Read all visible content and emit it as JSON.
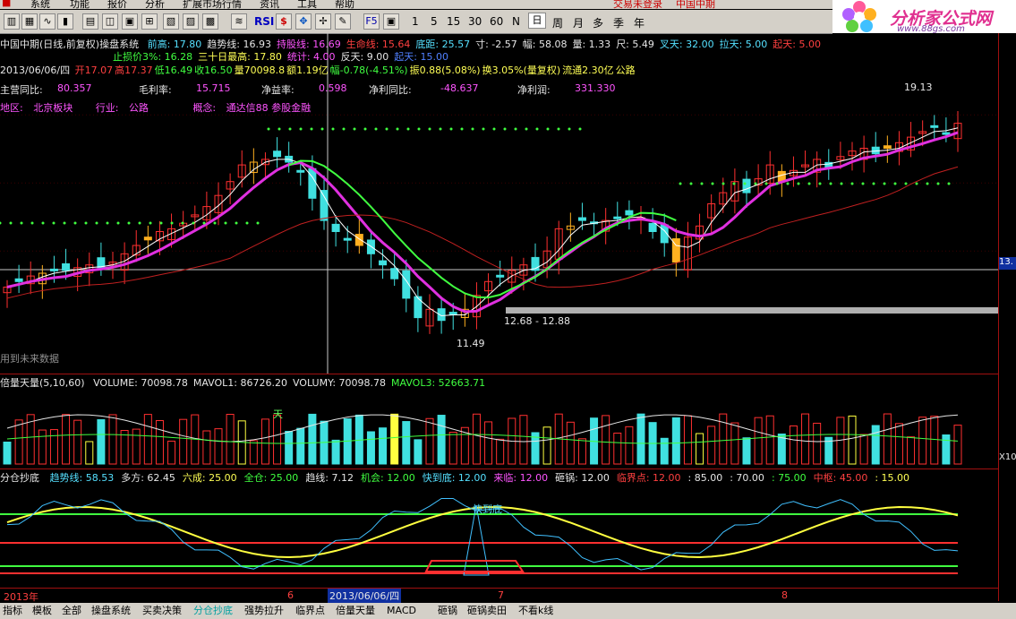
{
  "menu": [
    "系统",
    "功能",
    "报价",
    "分析",
    "扩展市场行情",
    "资讯",
    "工具",
    "帮助"
  ],
  "top_status": "交易未登录",
  "top_stock": "中国中期",
  "toolbar": {
    "rsi_label": "RSI",
    "period_labels": [
      "1",
      "5",
      "15",
      "30",
      "60",
      "N",
      "日",
      "周",
      "月",
      "多",
      "季",
      "年"
    ]
  },
  "brand": {
    "title": "分析家公式网",
    "url": "www.88gs.com"
  },
  "header": {
    "line1": {
      "title": "中国中期(日线,前复权)操盘系统",
      "items": [
        {
          "text": "前高: 17.80",
          "color": "#55e0ff"
        },
        {
          "text": "趋势线: 16.93",
          "color": "#e6e6e6"
        },
        {
          "text": "持股线: 16.69",
          "color": "#ff55ff"
        },
        {
          "text": "生命线: 15.64",
          "color": "#ff4040"
        },
        {
          "text": "底距: 25.57",
          "color": "#55e0ff"
        },
        {
          "text": "寸: -2.57",
          "color": "#e6e6e6"
        },
        {
          "text": "幅: 58.08",
          "color": "#e6e6e6"
        },
        {
          "text": "量: 1.33",
          "color": "#e6e6e6"
        },
        {
          "text": "尺: 5.49",
          "color": "#e6e6e6"
        },
        {
          "text": "叉天: 32.00",
          "color": "#55e0ff"
        },
        {
          "text": "拉天: 5.00",
          "color": "#55e0ff"
        },
        {
          "text": "起天: 5.00",
          "color": "#ff4040"
        }
      ]
    },
    "line2": [
      {
        "text": "止损价3%: 16.28",
        "color": "#40ff40"
      },
      {
        "text": "三十日最高: 17.80",
        "color": "#ffff55"
      },
      {
        "text": "统计: 4.00",
        "color": "#ff55ff"
      },
      {
        "text": "反天: 9.00",
        "color": "#e6e6e6"
      },
      {
        "text": "起天: 15.00",
        "color": "#5080ff"
      }
    ],
    "line3": {
      "date": "2013/06/06/四",
      "items": [
        {
          "text": "开17.07",
          "color": "#ff4040"
        },
        {
          "text": "高17.37",
          "color": "#ff4040"
        },
        {
          "text": "低16.49",
          "color": "#40ff40"
        },
        {
          "text": "收16.50",
          "color": "#40ff40"
        },
        {
          "text": "量70098.8",
          "color": "#ffff55"
        },
        {
          "text": "额1.19亿",
          "color": "#ffff55"
        },
        {
          "text": "幅-0.78(-4.51%)",
          "color": "#40ff40"
        },
        {
          "text": "振0.88(5.08%)",
          "color": "#ffff55"
        },
        {
          "text": "换3.05%(量复权)",
          "color": "#ffff55"
        },
        {
          "text": "流通2.30亿",
          "color": "#ffff55"
        },
        {
          "text": "公路",
          "color": "#ffff55"
        }
      ]
    },
    "fundamentals": [
      {
        "label": "主营同比:",
        "value": "80.357"
      },
      {
        "label": "毛利率:",
        "value": "15.715"
      },
      {
        "label": "净益率:",
        "value": "0.598"
      },
      {
        "label": "净利同比:",
        "value": "-48.637"
      },
      {
        "label": "净利润:",
        "value": "331.330"
      }
    ],
    "region": {
      "label1": "地区:",
      "value1": "北京板块",
      "label2": "行业:",
      "value2": "公路",
      "label3": "概念:",
      "value3": "通达信88 参股金融"
    }
  },
  "annotations": {
    "high": "19.13",
    "low": "11.49",
    "range": "12.68 - 12.88",
    "footer": "用到未来数据",
    "price_tag": "13."
  },
  "volume_panel": {
    "title": "倍量天量(5,10,60)",
    "items": [
      {
        "text": "VOLUME: 70098.78",
        "color": "#e6e6e6"
      },
      {
        "text": "MAVOL1: 86726.20",
        "color": "#e6e6e6"
      },
      {
        "text": "VOLUMY: 70098.78",
        "color": "#e6e6e6"
      },
      {
        "text": "MAVOL3: 52663.71",
        "color": "#40ff40"
      }
    ],
    "tag_tian": "天",
    "axis_label": "X10"
  },
  "indicator_panel": {
    "title": "分仓抄底",
    "items": [
      {
        "text": "趋势线: 58.53",
        "color": "#55e0ff"
      },
      {
        "text": "多方: 62.45",
        "color": "#e6e6e6"
      },
      {
        "text": "六成: 25.00",
        "color": "#ffff55"
      },
      {
        "text": "全仓: 25.00",
        "color": "#40ff40"
      },
      {
        "text": "趋线: 7.12",
        "color": "#e6e6e6"
      },
      {
        "text": "机会: 12.00",
        "color": "#40ff40"
      },
      {
        "text": "快到底: 12.00",
        "color": "#55e0ff"
      },
      {
        "text": "来临: 12.00",
        "color": "#ff55ff"
      },
      {
        "text": "砸锅: 12.00",
        "color": "#e6e6e6"
      },
      {
        "text": "临界点: 12.00",
        "color": "#ff4040"
      },
      {
        "text": ": 85.00",
        "color": "#e6e6e6"
      },
      {
        "text": ": 70.00",
        "color": "#e6e6e6"
      },
      {
        "text": ": 75.00",
        "color": "#40ff40"
      },
      {
        "text": "中枢: 45.00",
        "color": "#ff4040"
      },
      {
        "text": ": 15.00",
        "color": "#ffff55"
      }
    ],
    "tag": "快到底"
  },
  "time_axis": [
    "2013年",
    "6",
    "2013/06/06/四",
    "7",
    "8"
  ],
  "bottom_tabs": [
    "指标",
    "模板",
    "全部",
    "操盘系统",
    "买卖决策",
    "分仓抄底",
    "强势拉升",
    "临界点",
    "倍量天量",
    "MACD",
    "砸锅",
    "砸锅卖田",
    "不看k线"
  ],
  "active_tab": "分仓抄底",
  "colors": {
    "up": "#ff3030",
    "down": "#40e0e0",
    "ma_trend": "#ffffff",
    "ma_hold": "#e030e0",
    "ma_life": "#c02020",
    "green_line": "#40ff40",
    "yellow": "#ffff40"
  }
}
